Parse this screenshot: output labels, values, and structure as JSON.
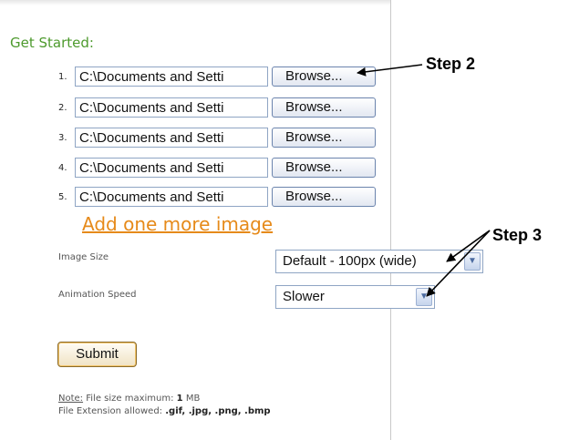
{
  "form": {
    "title": "Get Started:",
    "rows": [
      {
        "num": "1.",
        "path": "C:\\Documents and Setti",
        "browse": "Browse..."
      },
      {
        "num": "2.",
        "path": "C:\\Documents and Setti",
        "browse": "Browse..."
      },
      {
        "num": "3.",
        "path": "C:\\Documents and Setti",
        "browse": "Browse..."
      },
      {
        "num": "4.",
        "path": "C:\\Documents and Setti",
        "browse": "Browse..."
      },
      {
        "num": "5.",
        "path": "C:\\Documents and Setti",
        "browse": "Browse..."
      }
    ],
    "add_link": "Add one more image",
    "image_size": {
      "label": "Image Size",
      "value": "Default - 100px (wide)"
    },
    "animation_speed": {
      "label": "Animation Speed",
      "value": "Slower"
    },
    "submit": "Submit",
    "note": {
      "note_label": "Note:",
      "size_text": "File size maximum:",
      "size_num": "1",
      "size_unit": "MB",
      "ext_text": "File Extension allowed:",
      "ext_value": ".gif, .jpg, .png, .bmp"
    }
  },
  "annotations": {
    "step2": "Step 2",
    "step3": "Step 3"
  },
  "colors": {
    "title_green": "#4d9a2d",
    "link_orange": "#e68a1a"
  },
  "icons": {
    "select_arrow": "chevron-down-icon"
  }
}
